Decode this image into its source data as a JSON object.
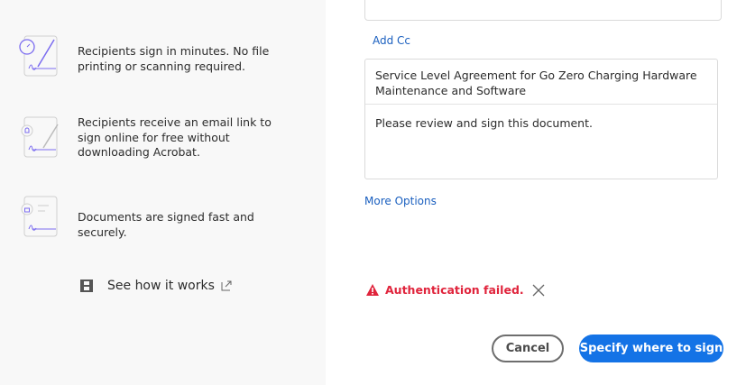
{
  "features": [
    {
      "icon": "stopwatch-document-icon",
      "text": "Recipients sign in minutes. No file printing or scanning required."
    },
    {
      "icon": "bell-document-icon",
      "text": "Recipients receive an email link to sign online for free without downloading Acrobat."
    },
    {
      "icon": "lock-document-icon",
      "text": "Documents are signed fast and securely."
    }
  ],
  "see_how": {
    "label": "See how it works",
    "icon": "film-icon",
    "external_icon": "external-link-icon"
  },
  "form": {
    "add_cc": "Add Cc",
    "subject": "Service Level Agreement for Go Zero Charging Hardware Maintenance and Software",
    "message": "Please review and sign this document.",
    "more_options": "More Options"
  },
  "error": {
    "text": "Authentication failed.",
    "color": "#e0243c"
  },
  "buttons": {
    "cancel": "Cancel",
    "primary": "Specify where to sign",
    "primary_color": "#1473e6"
  }
}
